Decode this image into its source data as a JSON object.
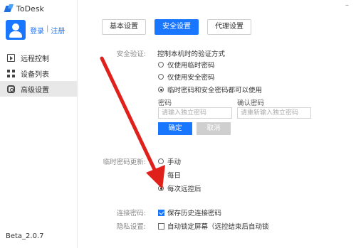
{
  "app": {
    "title": "ToDesk"
  },
  "user": {
    "login": "登录",
    "sep": "|",
    "register": "注册"
  },
  "nav": [
    {
      "label": "远程控制",
      "icon": "remote-control-icon"
    },
    {
      "label": "设备列表",
      "icon": "device-grid-icon"
    },
    {
      "label": "高级设置",
      "icon": "settings-gear-icon",
      "active": true
    }
  ],
  "version": "Beta_2.0.7",
  "window": {
    "minimize": "–"
  },
  "tabs": [
    {
      "label": "基本设置",
      "active": false
    },
    {
      "label": "安全设置",
      "active": true
    },
    {
      "label": "代理设置",
      "active": false
    }
  ],
  "security": {
    "label": "安全验证:",
    "heading": "控制本机时的验证方式",
    "options": [
      {
        "label": "仅使用临时密码",
        "selected": false
      },
      {
        "label": "仅使用安全密码",
        "selected": false
      },
      {
        "label": "临时密码和安全密码都可以使用",
        "selected": true
      }
    ],
    "password_label": "密码",
    "confirm_label": "确认密码",
    "password_placeholder": "请输入独立密码",
    "confirm_placeholder": "请重新输入独立密码",
    "ok": "确定",
    "cancel": "取消"
  },
  "temp_password": {
    "label": "临时密码更新:",
    "options": [
      {
        "label": "手动",
        "selected": false
      },
      {
        "label": "每日",
        "selected": false
      },
      {
        "label": "每次远控后",
        "selected": true
      }
    ]
  },
  "connection": {
    "label": "连接密码:",
    "option": "保存历史连接密码",
    "checked": true
  },
  "privacy": {
    "label": "隐私设置:",
    "option": "自动锁定屏幕（远控结束后自动锁",
    "checked": false
  },
  "colors": {
    "accent": "#1976ff",
    "arrow": "#e0211b"
  }
}
